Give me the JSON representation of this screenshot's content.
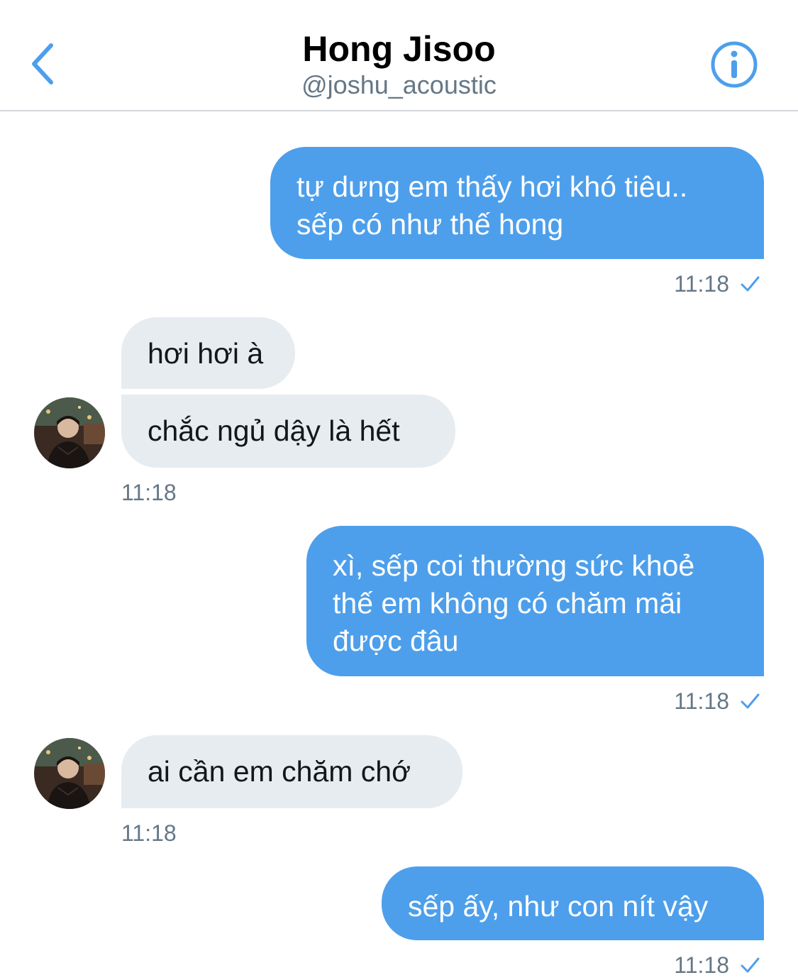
{
  "header": {
    "name": "Hong Jisoo",
    "handle": "@joshu_acoustic",
    "back_icon": "chevron-left-icon",
    "info_icon": "info-circle-icon"
  },
  "colors": {
    "accent": "#4d9feb",
    "received_bubble": "#e6ecf0",
    "meta_text": "#657786"
  },
  "messages": [
    {
      "direction": "sent",
      "lines": [
        "tự dưng em thấy hơi khó tiêu..",
        "sếp có như thế hong"
      ],
      "time": "11:18",
      "status_icon": "check-icon"
    },
    {
      "direction": "received",
      "lines": [
        "hơi hơi à"
      ]
    },
    {
      "direction": "received",
      "lines": [
        "chắc ngủ dậy là hết"
      ],
      "time": "11:18",
      "avatar": "avatar"
    },
    {
      "direction": "sent",
      "lines": [
        "xì, sếp coi thường sức khoẻ",
        "thế em không có chăm mãi",
        "được đâu"
      ],
      "time": "11:18",
      "status_icon": "check-icon"
    },
    {
      "direction": "received",
      "lines": [
        "ai cần em chăm chớ"
      ],
      "time": "11:18",
      "avatar": "avatar"
    },
    {
      "direction": "sent",
      "lines": [
        "sếp ấy, như con nít vậy"
      ],
      "time": "11:18",
      "status_icon": "check-icon"
    }
  ]
}
